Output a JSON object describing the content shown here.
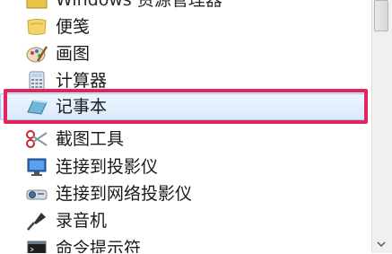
{
  "items": [
    {
      "label": "Windows 资源管理器",
      "icon": "folder-icon"
    },
    {
      "label": "便笺",
      "icon": "sticky-note-icon"
    },
    {
      "label": "画图",
      "icon": "paint-icon"
    },
    {
      "label": "计算器",
      "icon": "calculator-icon"
    },
    {
      "label": "记事本",
      "icon": "notepad-icon",
      "selected": true
    },
    {
      "label": "截图工具",
      "icon": "scissors-icon"
    },
    {
      "label": "连接到投影仪",
      "icon": "monitor-icon"
    },
    {
      "label": "连接到网络投影仪",
      "icon": "projector-icon"
    },
    {
      "label": "录音机",
      "icon": "microphone-icon"
    },
    {
      "label": "命令提示符",
      "icon": "command-prompt-icon"
    }
  ],
  "colors": {
    "highlight_border": "#e0245e",
    "selection_fill": "#dbe9fb"
  }
}
